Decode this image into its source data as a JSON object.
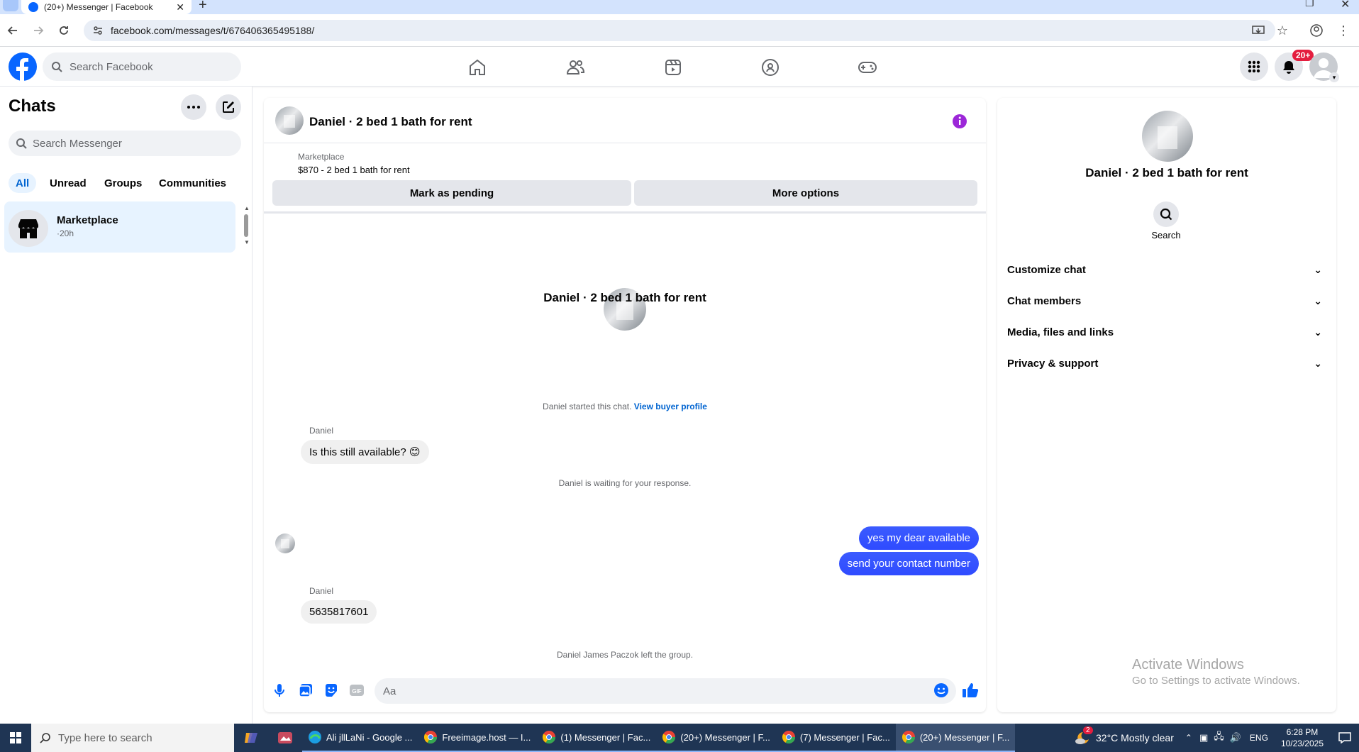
{
  "browser": {
    "tab_title": "(20+) Messenger | Facebook",
    "url": "facebook.com/messages/t/676406365495188/"
  },
  "fb": {
    "search_placeholder": "Search Facebook",
    "notifications_badge": "20+",
    "brand_color": "#0866ff"
  },
  "sidebar": {
    "title": "Chats",
    "search_placeholder": "Search Messenger",
    "filters": [
      "All",
      "Unread",
      "Groups",
      "Communities"
    ],
    "chats": [
      {
        "name": "Marketplace",
        "time": "·20h"
      }
    ]
  },
  "chat": {
    "title": "Daniel · 2 bed 1 bath for rent",
    "listing_source": "Marketplace",
    "listing_title": "$870 - 2 bed 1 bath for rent",
    "mark_pending": "Mark as pending",
    "more_options": "More options",
    "intro_name": "Daniel · 2 bed 1 bath for rent",
    "started_text": "Daniel started this chat.",
    "view_buyer": "View buyer profile",
    "messages": [
      {
        "sender": "Daniel",
        "text": "Is this still available? 😊"
      },
      {
        "system": "Daniel is waiting for your response."
      },
      {
        "outgoing": "yes my dear available"
      },
      {
        "outgoing": "send your contact number"
      },
      {
        "sender": "Daniel",
        "text": "5635817601"
      },
      {
        "system": "Daniel James Paczok left the group."
      }
    ],
    "composer_placeholder": "Aa"
  },
  "info_panel": {
    "name": "Daniel · 2 bed 1 bath for rent",
    "search_label": "Search",
    "sections": [
      "Customize chat",
      "Chat members",
      "Media, files and links",
      "Privacy & support"
    ]
  },
  "watermark": {
    "line1": "Activate Windows",
    "line2": "Go to Settings to activate Windows."
  },
  "taskbar": {
    "search_placeholder": "Type here to search",
    "apps": [
      "Ali jllLaNi - Google ...",
      "Freeimage.host — I...",
      "(1) Messenger | Fac...",
      "(20+) Messenger | F...",
      "(7) Messenger | Fac...",
      "(20+) Messenger | F..."
    ],
    "weather": "32°C  Mostly clear",
    "weather_badge": "2",
    "lang": "ENG",
    "time": "6:28 PM",
    "date": "10/23/2025"
  }
}
